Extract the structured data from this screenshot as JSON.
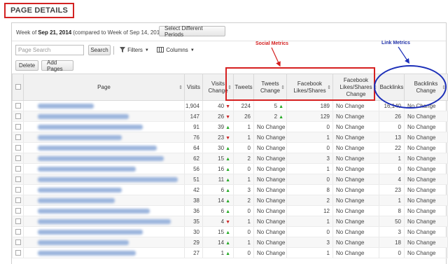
{
  "header": {
    "title": "PAGE DETAILS"
  },
  "toolbar": {
    "week_prefix": "Week of",
    "week_date": "Sep 21, 2014",
    "week_compare": "(compared to Week of Sep 14, 2014)",
    "select_periods_label": "Select Different Periods",
    "search_placeholder": "Page Search",
    "search_label": "Search",
    "filters_label": "Filters",
    "columns_label": "Columns",
    "delete_label": "Delete",
    "add_pages_label": "Add Pages"
  },
  "annotations": {
    "social_label": "Social Metrics",
    "link_label": "Link Metrics",
    "social_color": "#d41f1f",
    "link_color": "#1c2fb8"
  },
  "table": {
    "headers": {
      "page": "Page",
      "visits": "Visits",
      "visits_change": "Visits Change",
      "tweets": "Tweets",
      "tweets_change": "Tweets Change",
      "fb": "Facebook Likes/Shares",
      "fb_change": "Facebook Likes/Shares Change",
      "backlinks": "Backlinks",
      "backlinks_change": "Backlinks Change"
    },
    "rows": [
      {
        "visits": "1,904",
        "vchg": "40",
        "vdir": "down",
        "tweets": "224",
        "tchg": "5",
        "tdir": "up",
        "fb": "189",
        "fbchg": "No Change",
        "bl": "16,140",
        "blchg": "No Change"
      },
      {
        "visits": "147",
        "vchg": "26",
        "vdir": "down",
        "tweets": "26",
        "tchg": "2",
        "tdir": "up",
        "fb": "129",
        "fbchg": "No Change",
        "bl": "26",
        "blchg": "No Change"
      },
      {
        "visits": "91",
        "vchg": "39",
        "vdir": "up",
        "tweets": "1",
        "tchg": "No Change",
        "tdir": "",
        "fb": "0",
        "fbchg": "No Change",
        "bl": "0",
        "blchg": "No Change"
      },
      {
        "visits": "76",
        "vchg": "23",
        "vdir": "down",
        "tweets": "1",
        "tchg": "No Change",
        "tdir": "",
        "fb": "1",
        "fbchg": "No Change",
        "bl": "13",
        "blchg": "No Change"
      },
      {
        "visits": "64",
        "vchg": "30",
        "vdir": "up",
        "tweets": "0",
        "tchg": "No Change",
        "tdir": "",
        "fb": "0",
        "fbchg": "No Change",
        "bl": "22",
        "blchg": "No Change"
      },
      {
        "visits": "62",
        "vchg": "15",
        "vdir": "up",
        "tweets": "2",
        "tchg": "No Change",
        "tdir": "",
        "fb": "3",
        "fbchg": "No Change",
        "bl": "1",
        "blchg": "No Change"
      },
      {
        "visits": "56",
        "vchg": "16",
        "vdir": "up",
        "tweets": "0",
        "tchg": "No Change",
        "tdir": "",
        "fb": "1",
        "fbchg": "No Change",
        "bl": "0",
        "blchg": "No Change"
      },
      {
        "visits": "51",
        "vchg": "11",
        "vdir": "up",
        "tweets": "1",
        "tchg": "No Change",
        "tdir": "",
        "fb": "0",
        "fbchg": "No Change",
        "bl": "4",
        "blchg": "No Change"
      },
      {
        "visits": "42",
        "vchg": "6",
        "vdir": "up",
        "tweets": "3",
        "tchg": "No Change",
        "tdir": "",
        "fb": "8",
        "fbchg": "No Change",
        "bl": "23",
        "blchg": "No Change"
      },
      {
        "visits": "38",
        "vchg": "14",
        "vdir": "up",
        "tweets": "2",
        "tchg": "No Change",
        "tdir": "",
        "fb": "2",
        "fbchg": "No Change",
        "bl": "1",
        "blchg": "No Change"
      },
      {
        "visits": "36",
        "vchg": "6",
        "vdir": "up",
        "tweets": "0",
        "tchg": "No Change",
        "tdir": "",
        "fb": "12",
        "fbchg": "No Change",
        "bl": "8",
        "blchg": "No Change"
      },
      {
        "visits": "35",
        "vchg": "4",
        "vdir": "down",
        "tweets": "1",
        "tchg": "No Change",
        "tdir": "",
        "fb": "1",
        "fbchg": "No Change",
        "bl": "50",
        "blchg": "No Change"
      },
      {
        "visits": "30",
        "vchg": "15",
        "vdir": "up",
        "tweets": "0",
        "tchg": "No Change",
        "tdir": "",
        "fb": "0",
        "fbchg": "No Change",
        "bl": "3",
        "blchg": "No Change"
      },
      {
        "visits": "29",
        "vchg": "14",
        "vdir": "up",
        "tweets": "1",
        "tchg": "No Change",
        "tdir": "",
        "fb": "3",
        "fbchg": "No Change",
        "bl": "18",
        "blchg": "No Change"
      },
      {
        "visits": "27",
        "vchg": "1",
        "vdir": "up",
        "tweets": "0",
        "tchg": "No Change",
        "tdir": "",
        "fb": "1",
        "fbchg": "No Change",
        "bl": "0",
        "blchg": "No Change"
      }
    ]
  }
}
